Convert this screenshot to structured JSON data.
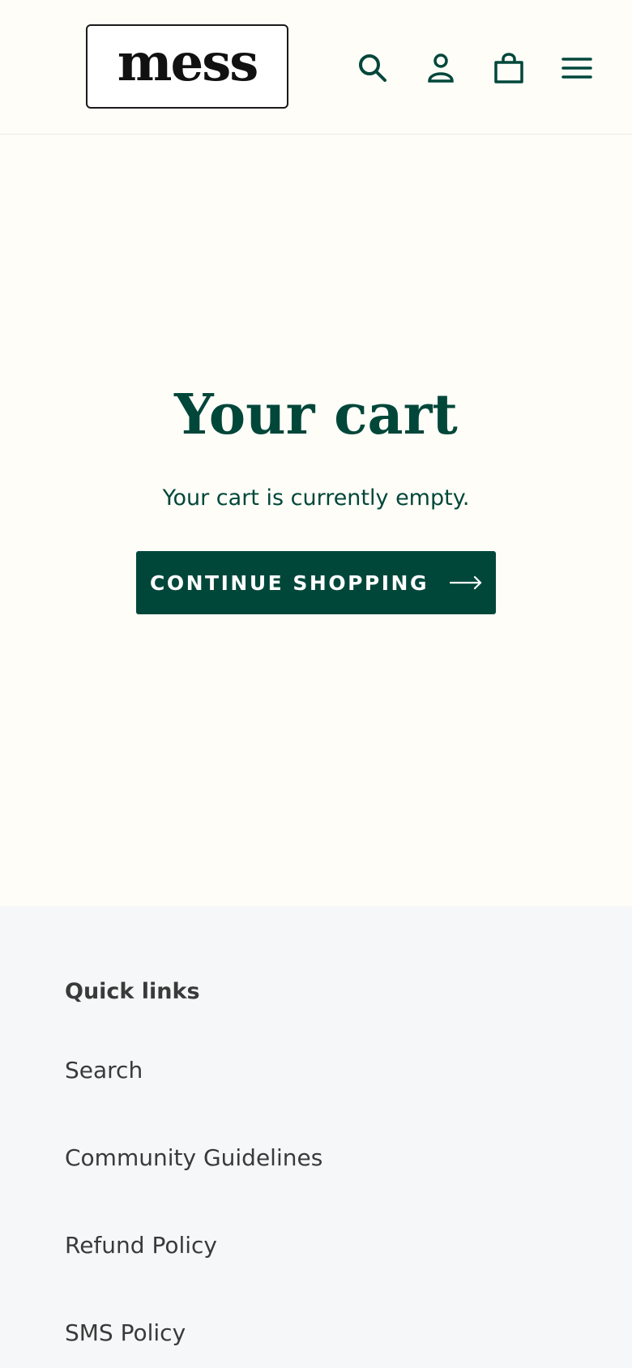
{
  "header": {
    "logo_text": "mess",
    "icons": {
      "search": "search-icon",
      "account": "account-icon",
      "cart": "cart-icon",
      "menu": "menu-icon"
    }
  },
  "cart": {
    "title": "Your cart",
    "empty_message": "Your cart is currently empty.",
    "continue_label": "CONTINUE SHOPPING",
    "continue_icon": "arrow-right-icon"
  },
  "footer": {
    "heading": "Quick links",
    "links": [
      {
        "label": "Search"
      },
      {
        "label": "Community Guidelines"
      },
      {
        "label": "Refund Policy"
      },
      {
        "label": "SMS Policy"
      }
    ]
  },
  "colors": {
    "brand": "#00473a",
    "page_background": "#fffdf7",
    "footer_background": "#f6f7f8",
    "footer_text": "#3a3a3a"
  }
}
